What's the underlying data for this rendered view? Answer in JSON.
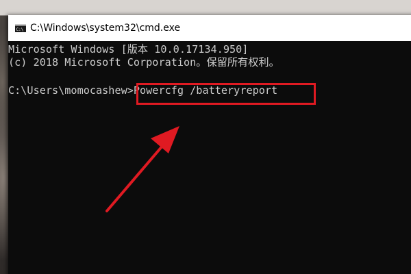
{
  "window": {
    "title": "C:\\Windows\\system32\\cmd.exe"
  },
  "console": {
    "line1": "Microsoft Windows [版本 10.0.17134.950]",
    "line2": "(c) 2018 Microsoft Corporation。保留所有权利。",
    "prompt": "C:\\Users\\momocashew>",
    "command": "Powercfg /batteryreport"
  },
  "annotation": {
    "highlight_color": "#e01a22",
    "arrow_color": "#e01a22"
  },
  "colors": {
    "console_bg": "#0c0c0c",
    "console_text": "#cccccc",
    "titlebar_bg": "#ffffff"
  },
  "icons": {
    "window_icon": "cmd-icon",
    "annotation_arrow": "arrow-icon"
  }
}
